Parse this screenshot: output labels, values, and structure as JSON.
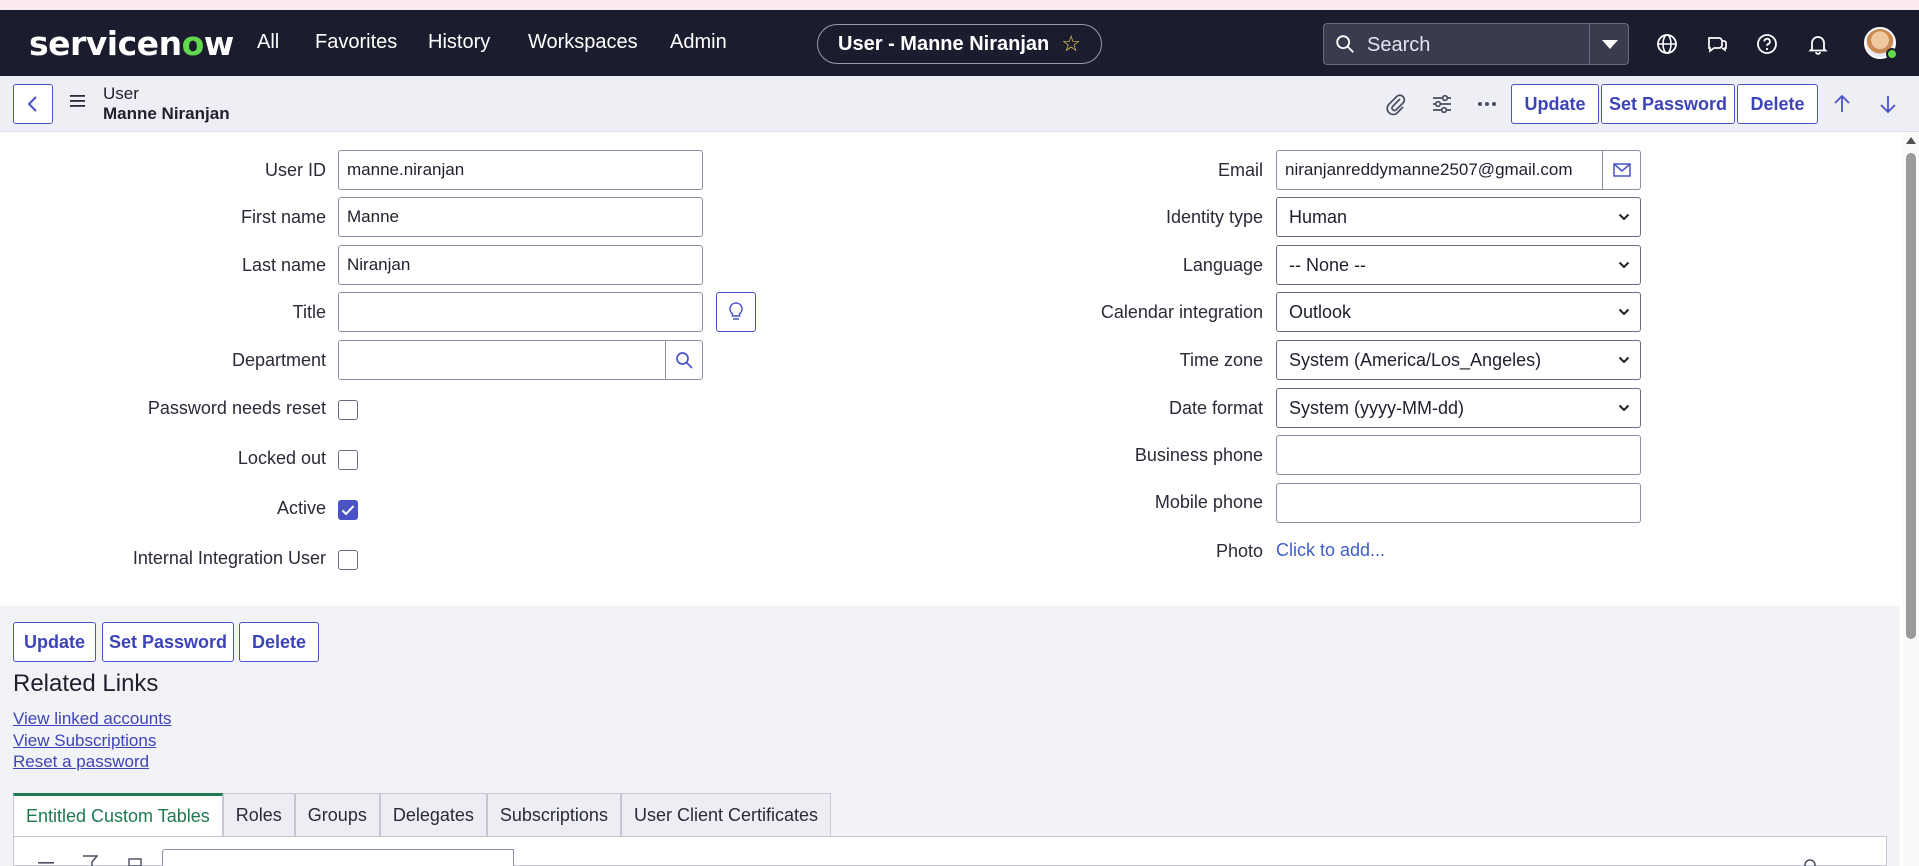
{
  "nav": {
    "logo_pre": "servicen",
    "logo_o": "o",
    "logo_post": "w",
    "items": [
      "All",
      "Favorites",
      "History",
      "Workspaces",
      "Admin"
    ],
    "context_title": "User - Manne Niranjan",
    "search_placeholder": "Search"
  },
  "header": {
    "record_type": "User",
    "record_name": "Manne Niranjan",
    "update_label": "Update",
    "set_password_label": "Set Password",
    "delete_label": "Delete"
  },
  "form": {
    "left": {
      "user_id_label": "User ID",
      "user_id_value": "manne.niranjan",
      "first_name_label": "First name",
      "first_name_value": "Manne",
      "last_name_label": "Last name",
      "last_name_value": "Niranjan",
      "title_label": "Title",
      "title_value": "",
      "department_label": "Department",
      "department_value": "",
      "password_reset_label": "Password needs reset",
      "locked_out_label": "Locked out",
      "active_label": "Active",
      "internal_integration_label": "Internal Integration User"
    },
    "checkboxes": {
      "password_reset": false,
      "locked_out": false,
      "active": true,
      "internal_integration": false
    },
    "right": {
      "email_label": "Email",
      "email_value": "niranjanreddymanne2507@gmail.com",
      "identity_type_label": "Identity type",
      "identity_type_value": "Human",
      "language_label": "Language",
      "language_value": "-- None --",
      "calendar_label": "Calendar integration",
      "calendar_value": "Outlook",
      "time_zone_label": "Time zone",
      "time_zone_value": "System (America/Los_Angeles)",
      "date_format_label": "Date format",
      "date_format_value": "System (yyyy-MM-dd)",
      "business_phone_label": "Business phone",
      "business_phone_value": "",
      "mobile_phone_label": "Mobile phone",
      "mobile_phone_value": "",
      "photo_label": "Photo",
      "photo_link": "Click to add..."
    }
  },
  "footer_buttons": {
    "update_label": "Update",
    "set_password_label": "Set Password",
    "delete_label": "Delete"
  },
  "related": {
    "title": "Related Links",
    "links": [
      "View linked accounts",
      "View Subscriptions",
      "Reset a password"
    ]
  },
  "tabs": [
    "Entitled Custom Tables",
    "Roles",
    "Groups",
    "Delegates",
    "Subscriptions",
    "User Client Certificates"
  ],
  "colors": {
    "nav_bg": "#1b1c2e",
    "accent": "#4b52c8",
    "active_tab": "#1d7a50",
    "logo_o": "#62d84e"
  }
}
